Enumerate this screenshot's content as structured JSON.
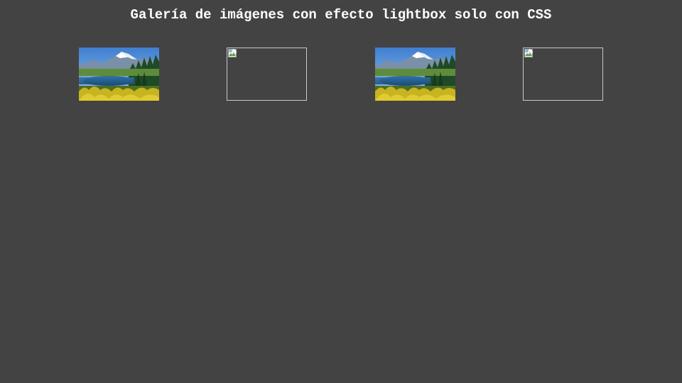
{
  "page": {
    "title": "Galería de imágenes con efecto lightbox solo con CSS",
    "background_color": "#434343",
    "text_color": "#ffffff"
  },
  "gallery": {
    "items": [
      {
        "type": "image",
        "icon": "landscape-photo"
      },
      {
        "type": "broken-image",
        "icon": "broken-image-icon"
      },
      {
        "type": "image",
        "icon": "landscape-photo"
      },
      {
        "type": "broken-image",
        "icon": "broken-image-icon"
      }
    ]
  }
}
